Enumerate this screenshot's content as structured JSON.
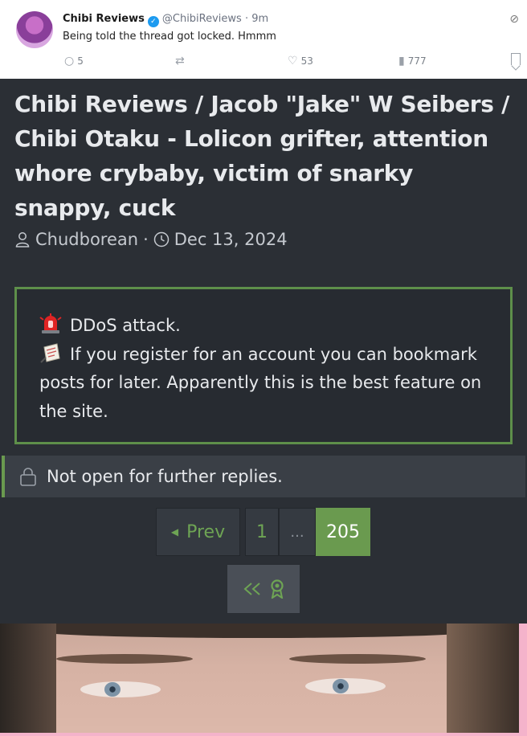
{
  "tweet": {
    "display_name": "Chibi Reviews",
    "handle_time": "@ChibiReviews · 9m",
    "text": "Being told the thread got locked. Hmmm",
    "replies": "5",
    "likes": "53",
    "views": "777"
  },
  "thread": {
    "title": "Chibi Reviews / Jacob \"Jake\" W Seibers / Chibi Otaku - Lolicon grifter, attention whore crybaby, victim of snarky snappy, cuck",
    "author": "Chudborean",
    "separator": "·",
    "date": "Dec 13, 2024"
  },
  "notice": {
    "line1": "DDoS attack.",
    "line2": "If you register for an account you can bookmark posts for later. Apparently this is the best feature on the site."
  },
  "locked": {
    "text": "Not open for further replies."
  },
  "pagination": {
    "prev_label": "Prev",
    "first_page": "1",
    "ellipsis": "...",
    "current_page": "205"
  },
  "colors": {
    "accent_green": "#6a9a4f",
    "background": "#2b2f35",
    "verified_blue": "#1d9bf0"
  },
  "icons": [
    "user-icon",
    "clock-icon",
    "siren-icon",
    "memo-icon",
    "lock-icon",
    "rewind-icon",
    "ribbon-icon",
    "reply-icon",
    "retweet-icon",
    "like-icon",
    "views-icon",
    "bookmark-icon",
    "grok-icon",
    "verified-icon"
  ]
}
